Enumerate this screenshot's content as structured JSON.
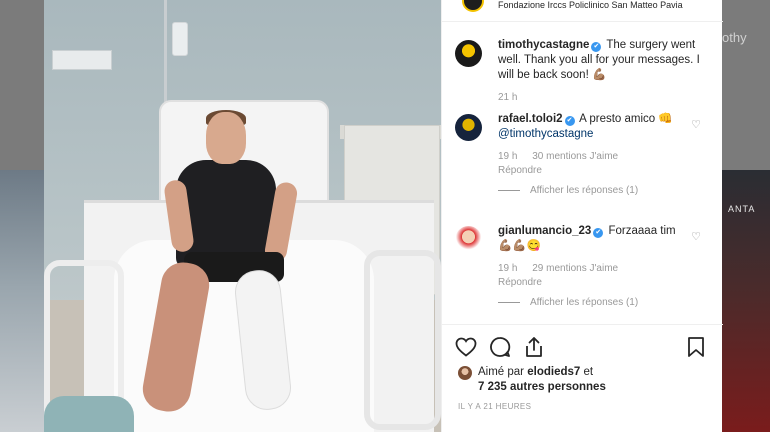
{
  "background": {
    "right_text_top": "othy",
    "right_photo_text": "ANTA"
  },
  "post": {
    "location": "Fondazione Irccs Policlinico San Matteo Pavia",
    "photo_alt": "Hospital bed photo"
  },
  "comments": [
    {
      "username": "timothycastagne",
      "verified": true,
      "text": "The surgery went well. Thank you all for your messages. I will be back soon! 💪🏽",
      "time": "21 h"
    },
    {
      "username": "rafael.toloi2",
      "verified": true,
      "text": "A presto amico 👊",
      "mention": "@timothycastagne",
      "time": "19 h",
      "likes": "30 mentions J'aime",
      "reply": "Répondre",
      "show_replies": "Afficher les réponses (1)"
    },
    {
      "username": "gianlumancio_23",
      "verified": true,
      "text": "Forzaaaa tim",
      "emojis": "💪🏽💪🏽😋",
      "time": "19 h",
      "likes": "29 mentions J'aime",
      "reply": "Répondre",
      "show_replies": "Afficher les réponses (1)"
    }
  ],
  "likes": {
    "prefix": "Aimé par",
    "user": "elodieds7",
    "suffix": "et",
    "others": "7 235 autres personnes"
  },
  "timeago": "IL Y A 21 HEURES",
  "icons": [
    "heart-icon",
    "comment-icon",
    "share-icon",
    "bookmark-icon"
  ],
  "colors": {
    "verified": "#3897f0",
    "mention": "#003569",
    "muted": "#999999"
  }
}
